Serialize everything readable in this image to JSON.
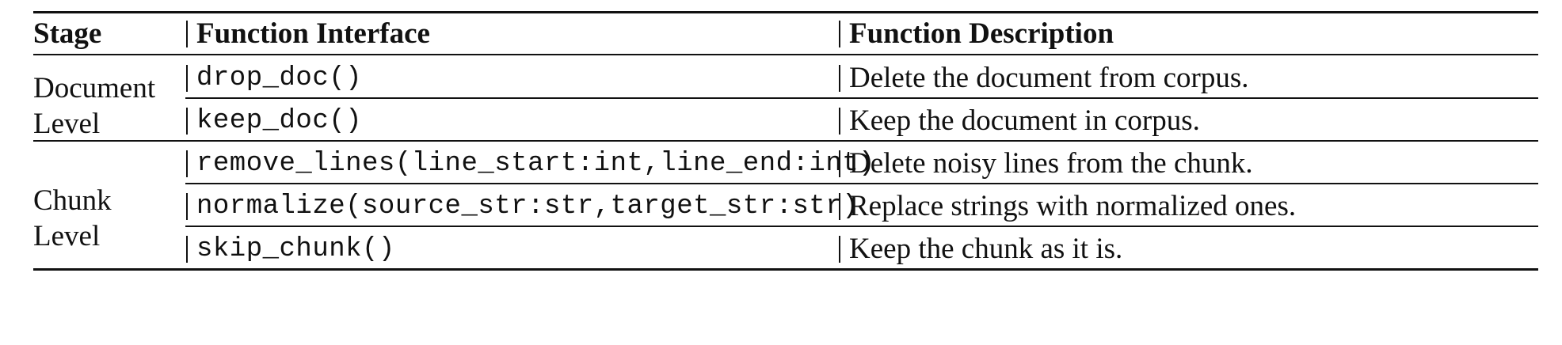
{
  "header": {
    "stage": "Stage",
    "interface": "Function Interface",
    "description": "Function Description"
  },
  "groups": [
    {
      "stage": "Document Level",
      "rows": [
        {
          "interface": "drop_doc()",
          "description": "Delete the document from corpus."
        },
        {
          "interface": "keep_doc()",
          "description": "Keep the document in corpus."
        }
      ]
    },
    {
      "stage": "Chunk Level",
      "rows": [
        {
          "interface": "remove_lines(line_start:int,line_end:int)",
          "description": "Delete noisy lines from the chunk."
        },
        {
          "interface": "normalize(source_str:str,target_str:str)",
          "description": "Replace strings with normalized ones."
        },
        {
          "interface": "skip_chunk()",
          "description": "Keep the chunk as it is."
        }
      ]
    }
  ]
}
